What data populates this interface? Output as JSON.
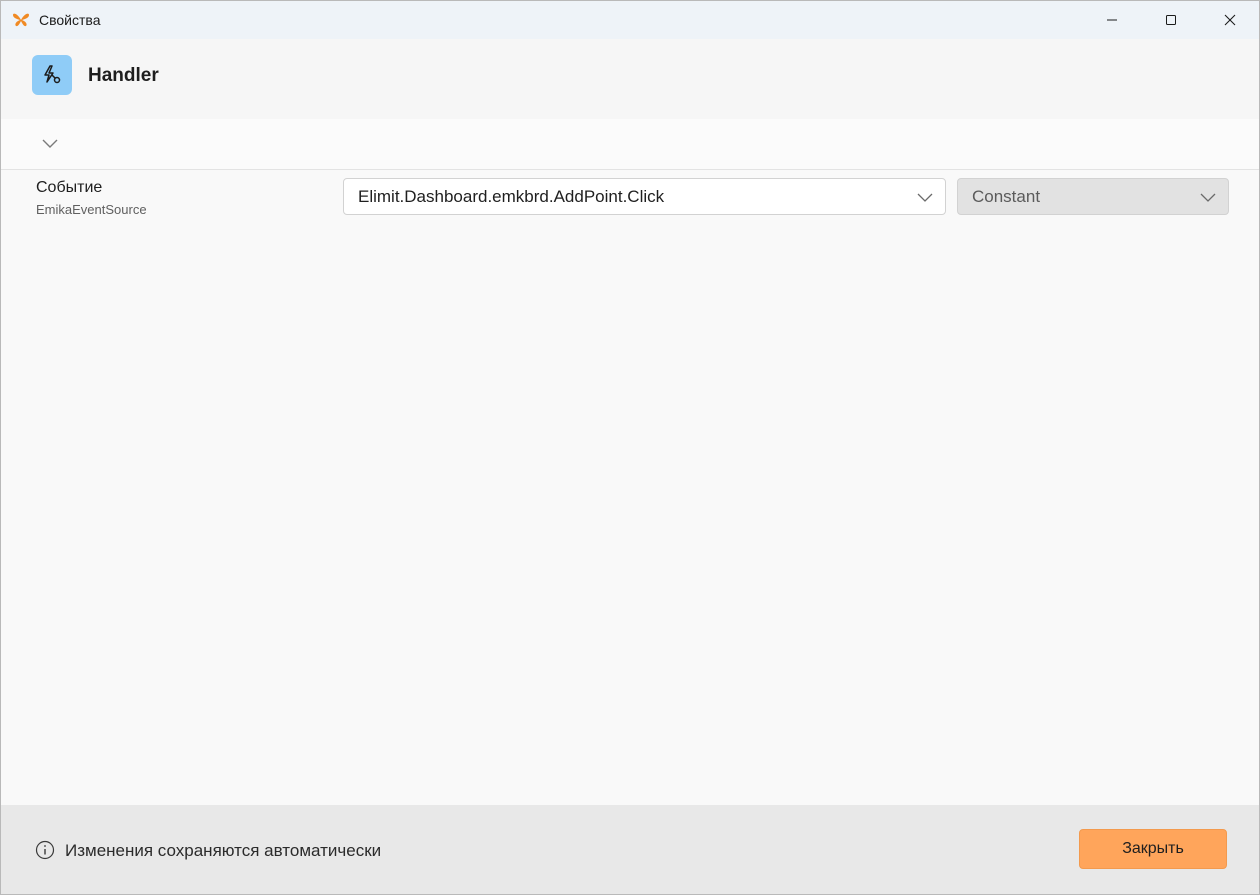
{
  "window": {
    "title": "Свойства",
    "app_icon": "butterfly-logo-icon",
    "controls": [
      "minimize-icon",
      "maximize-icon",
      "close-icon"
    ]
  },
  "header": {
    "icon": "handler-event-icon",
    "title": "Handler"
  },
  "collapse": {
    "icon": "chevron-down-icon"
  },
  "property": {
    "label": "Событие",
    "sublabel": "EmikaEventSource",
    "event_value": "Elimit.Dashboard.emkbrd.AddPoint.Click",
    "kind_value": "Constant"
  },
  "footer": {
    "info_icon": "info-icon",
    "info_text": "Изменения сохраняются автоматически",
    "close_label": "Закрыть"
  },
  "colors": {
    "accent": "#ffa55b",
    "header_icon_bg": "#8fccf7",
    "app_icon": "#f08a24"
  }
}
